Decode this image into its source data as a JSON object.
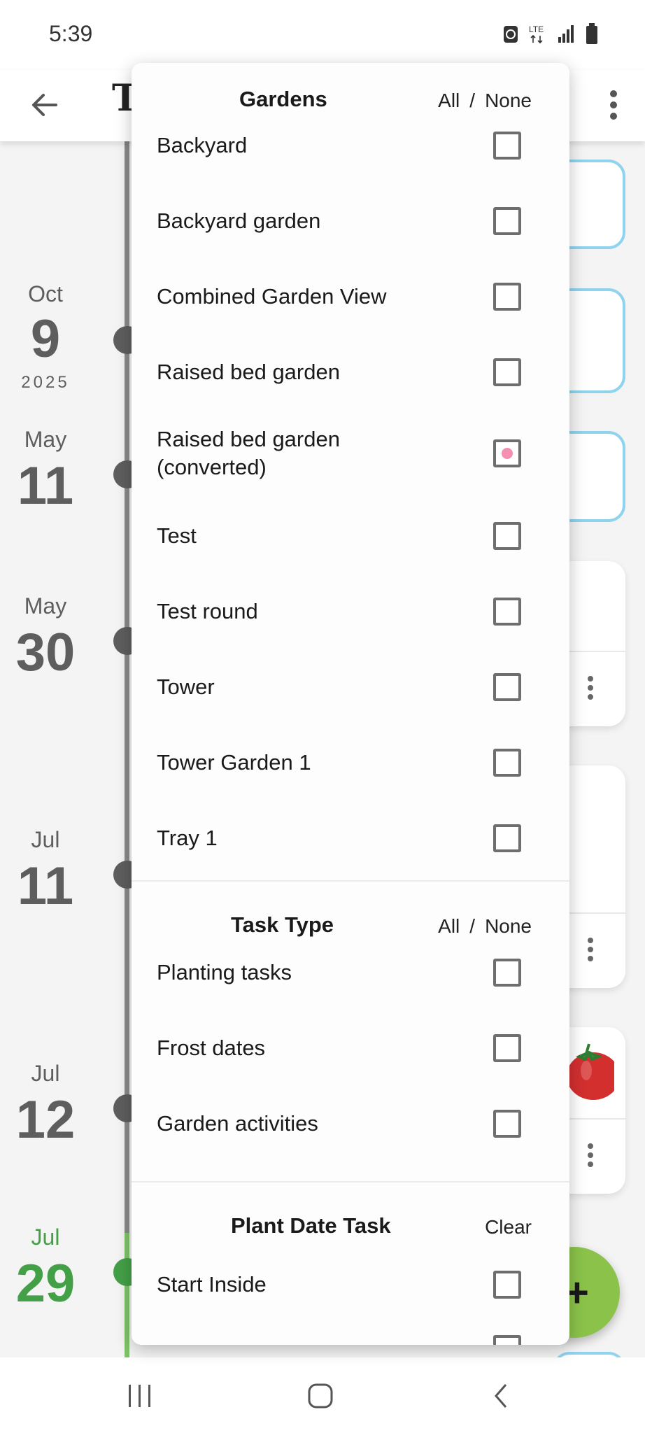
{
  "status_bar": {
    "time": "5:39",
    "network": "LTE"
  },
  "app_bar": {
    "title": "T"
  },
  "timeline": {
    "entries": [
      {
        "month": "Oct",
        "day": "9",
        "year": "2025"
      },
      {
        "month": "May",
        "day": "11"
      },
      {
        "month": "May",
        "day": "30"
      },
      {
        "month": "Jul",
        "day": "11"
      },
      {
        "month": "Jul",
        "day": "12"
      },
      {
        "month": "Jul",
        "day": "29",
        "highlight": true
      }
    ],
    "today_color": "#43a047"
  },
  "fab": {
    "label": "+"
  },
  "dropdown": {
    "gardens": {
      "title": "Gardens",
      "all_label": "All",
      "separator": "/",
      "none_label": "None",
      "options": [
        {
          "label": "Backyard",
          "checked": false
        },
        {
          "label": "Backyard garden",
          "checked": false
        },
        {
          "label": "Combined Garden View",
          "checked": false
        },
        {
          "label": "Raised bed garden",
          "checked": false
        },
        {
          "label_line1": "Raised bed garden",
          "label_line2": "(converted)",
          "checked": "partial"
        },
        {
          "label": "Test",
          "checked": false
        },
        {
          "label": "Test round",
          "checked": false
        },
        {
          "label": "Tower",
          "checked": false
        },
        {
          "label": "Tower Garden 1",
          "checked": false
        },
        {
          "label": "Tray 1",
          "checked": false
        }
      ]
    },
    "task_type": {
      "title": "Task Type",
      "all_label": "All",
      "separator": "/",
      "none_label": "None",
      "options": [
        {
          "label": "Planting tasks",
          "checked": false
        },
        {
          "label": "Frost dates",
          "checked": false
        },
        {
          "label": "Garden activities",
          "checked": false
        }
      ]
    },
    "plant_date_task": {
      "title": "Plant Date Task",
      "clear_label": "Clear",
      "options": [
        {
          "label": "Start Inside",
          "checked": false
        }
      ]
    }
  }
}
